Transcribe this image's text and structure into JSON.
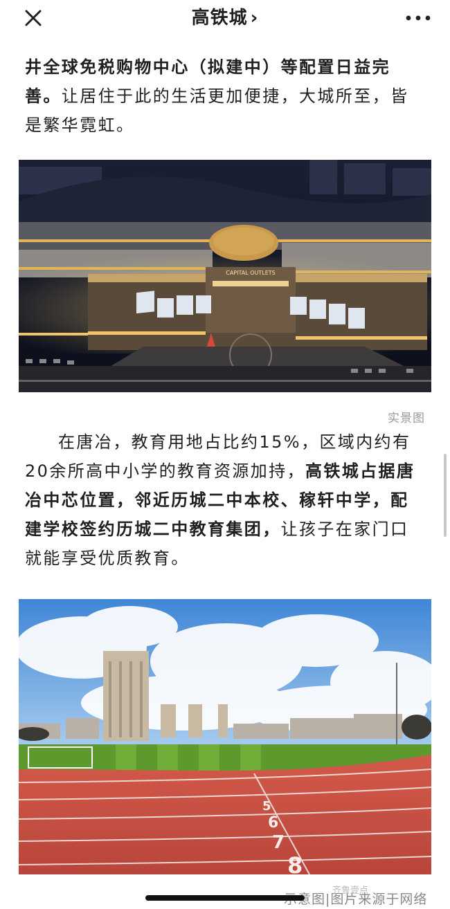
{
  "header": {
    "title": "高铁城",
    "chevron": "›",
    "close_icon": "close-icon",
    "more_icon": "more-dots-icon"
  },
  "article": {
    "para1_bold": "井全球免税购物中心（拟建中）等配置日益完善。",
    "para1_rest": "让居住于此的生活更加便捷，大城所至，皆是繁华霓虹。",
    "photo1_sign": "CAPITAL OUTLETS",
    "photo1_caption": "实景图",
    "para2_plain1": "在唐冶，教育用地占比约15%，区域内约有20余所高中小学的教育资源加持，",
    "para2_bold": "高铁城占据唐冶中芯位置，邻近历城二中本校、稼轩中学，配建学校签约历城二中教育集团，",
    "para2_plain2": "让孩子在家门口就能享受优质教育。",
    "photo2_lane_numbers": [
      "5",
      "6",
      "7",
      "8"
    ],
    "photo2_caption": "示意图|图片来源于网络",
    "watermark": "齐鲁壹点"
  },
  "colors": {
    "track": "#c64a3f",
    "grass": "#5c9a2e",
    "sky": "#4f8fd8",
    "night": "#0e1220",
    "building_glow": "#e9b85a"
  }
}
